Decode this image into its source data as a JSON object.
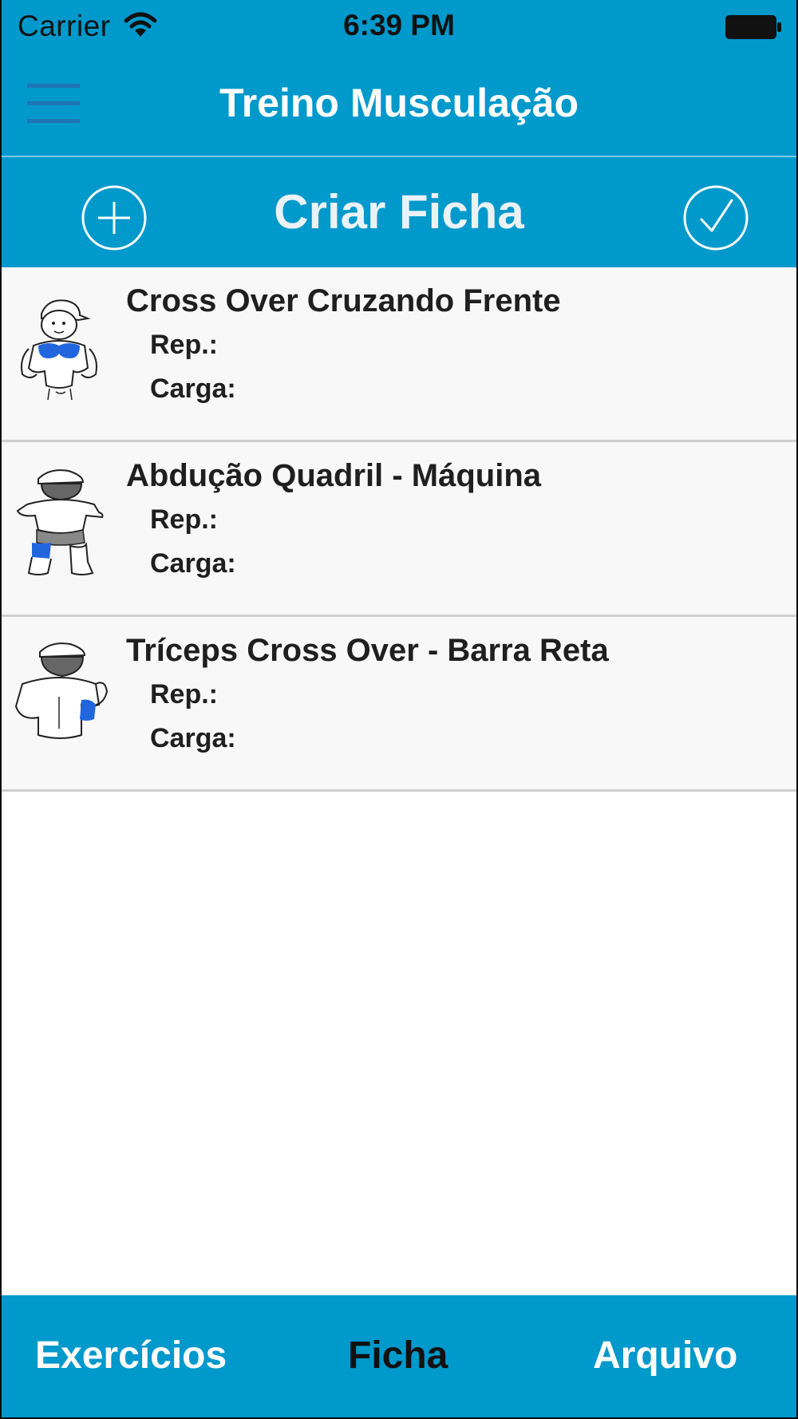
{
  "status_bar": {
    "carrier": "Carrier",
    "time": "6:39 PM"
  },
  "nav": {
    "title": "Treino Musculação",
    "menu_icon": "hamburger-icon"
  },
  "toolbar": {
    "title": "Criar Ficha",
    "add_icon": "plus-circle-icon",
    "confirm_icon": "check-circle-icon"
  },
  "exercises": [
    {
      "name": "Cross Over Cruzando Frente",
      "rep_label": "Rep.:",
      "carga_label": "Carga:",
      "highlight": "chest"
    },
    {
      "name": "Abdução Quadril - Máquina",
      "rep_label": "Rep.:",
      "carga_label": "Carga:",
      "highlight": "hip"
    },
    {
      "name": "Tríceps Cross Over - Barra Reta",
      "rep_label": "Rep.:",
      "carga_label": "Carga:",
      "highlight": "triceps"
    }
  ],
  "tabs": {
    "exercicios": "Exercícios",
    "ficha": "Ficha",
    "arquivo": "Arquivo",
    "active": "Ficha"
  },
  "colors": {
    "primary": "#0099cc",
    "highlight_blue": "#2266dd",
    "active_tab": "#111111",
    "inactive_tab": "#ffffff"
  }
}
